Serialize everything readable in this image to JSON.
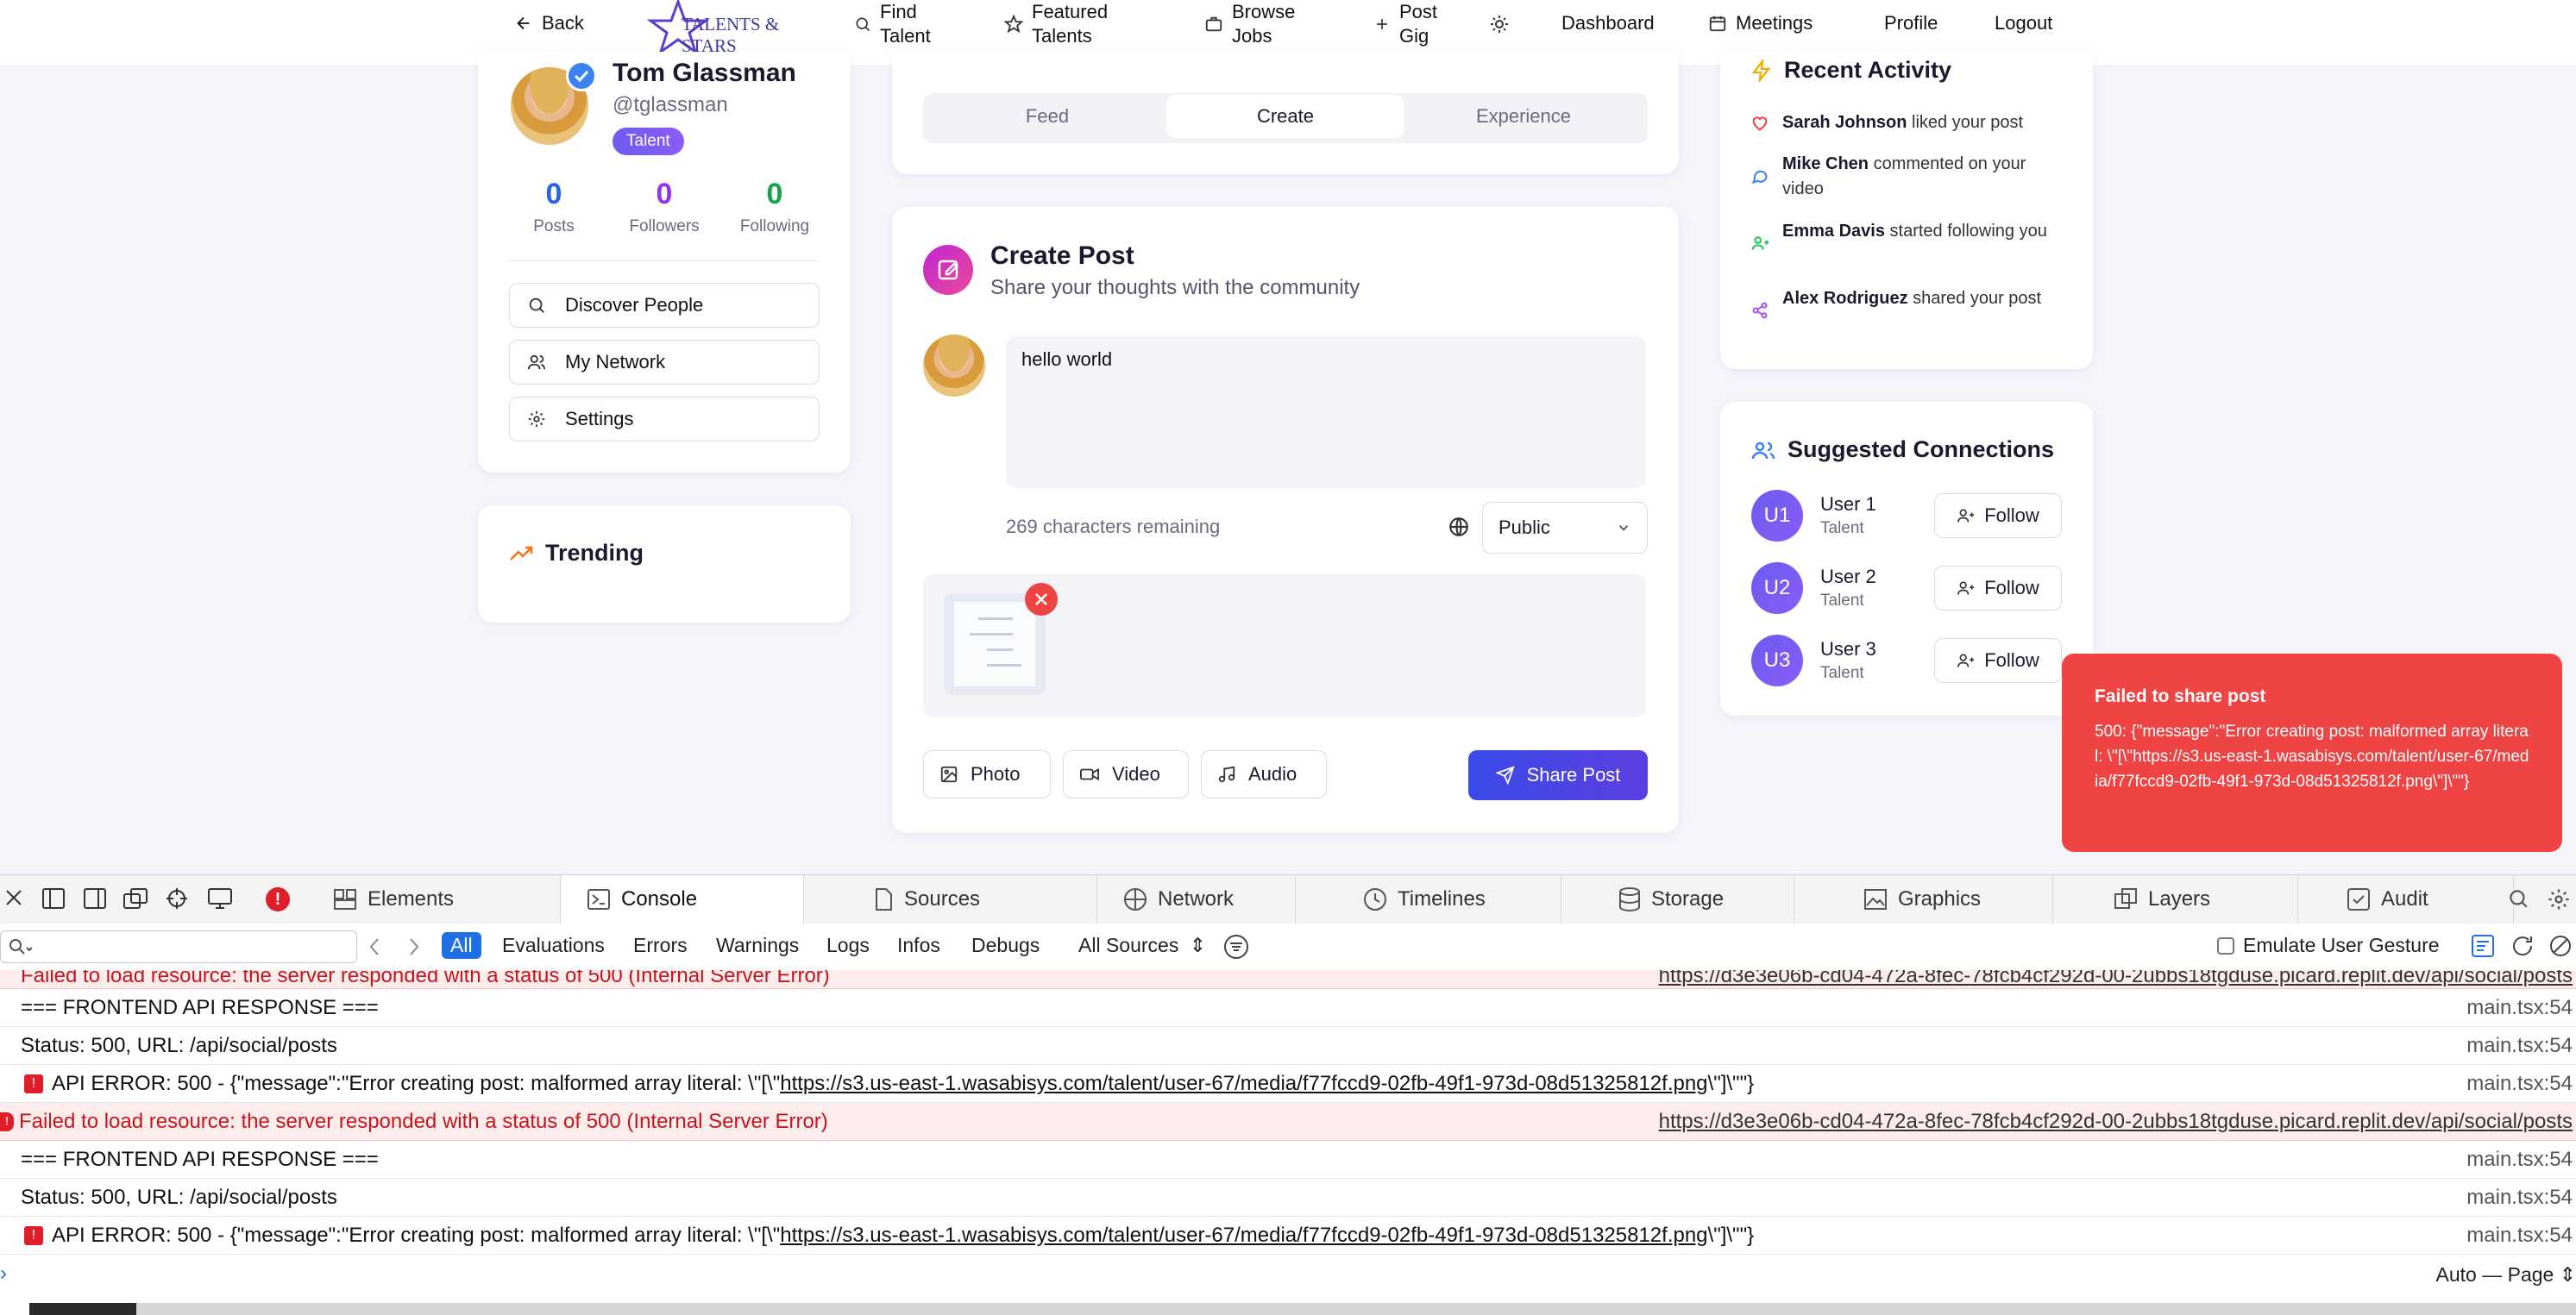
{
  "nav": {
    "back": "Back",
    "logo_text": "TALENTS & STARS",
    "find_talent": [
      "Find",
      "Talent"
    ],
    "featured_talents": [
      "Featured",
      "Talents"
    ],
    "browse_jobs": [
      "Browse",
      "Jobs"
    ],
    "post_gig": [
      "Post",
      "Gig"
    ],
    "dashboard": "Dashboard",
    "meetings": "Meetings",
    "profile": "Profile",
    "logout": "Logout"
  },
  "profile": {
    "name": "Tom Glassman",
    "handle": "@tglassman",
    "badge": "Talent",
    "stats": [
      {
        "value": "0",
        "label": "Posts",
        "color": "#2563eb"
      },
      {
        "value": "0",
        "label": "Followers",
        "color": "#9333ea"
      },
      {
        "value": "0",
        "label": "Following",
        "color": "#16a34a"
      }
    ],
    "links": [
      "Discover People",
      "My Network",
      "Settings"
    ]
  },
  "trending": {
    "title": "Trending"
  },
  "tabs": [
    "Feed",
    "Create",
    "Experience"
  ],
  "create_post": {
    "title": "Create Post",
    "subtitle": "Share your thoughts with the community",
    "text": "hello world",
    "chars_remaining": "269 characters remaining",
    "visibility": "Public",
    "buttons": {
      "photo": "Photo",
      "video": "Video",
      "audio": "Audio",
      "share": "Share Post"
    }
  },
  "recent_activity": {
    "title": "Recent Activity",
    "items": [
      {
        "who": "Sarah Johnson",
        "what": " liked your post",
        "icon": "heart-icon"
      },
      {
        "who": "Mike Chen",
        "what": " commented on your video",
        "icon": "message-icon"
      },
      {
        "who": "Emma Davis",
        "what": " started following you",
        "icon": "user-plus-icon"
      },
      {
        "who": "Alex Rodriguez",
        "what": " shared your post",
        "icon": "share-icon"
      }
    ]
  },
  "suggested": {
    "title": "Suggested Connections",
    "follow_label": "Follow",
    "users": [
      {
        "initials": "U1",
        "name": "User 1",
        "role": "Talent"
      },
      {
        "initials": "U2",
        "name": "User 2",
        "role": "Talent"
      },
      {
        "initials": "U3",
        "name": "User 3",
        "role": "Talent"
      }
    ]
  },
  "toast": {
    "title": "Failed to share post",
    "message": "500: {\"message\":\"Error creating post: malformed array literal: \\\"[\\\"https://s3.us-east-1.wasabisys.com/talent/user-67/media/f77fccd9-02fb-49f1-973d-08d51325812f.png\\\"]\\\"\"}"
  },
  "devtools": {
    "tabs": [
      "Elements",
      "Console",
      "Sources",
      "Network",
      "Timelines",
      "Storage",
      "Graphics",
      "Layers",
      "Audit"
    ],
    "filters": [
      "All",
      "Evaluations",
      "Errors",
      "Warnings",
      "Logs",
      "Infos",
      "Debugs"
    ],
    "all_sources": "All Sources",
    "emulate": "Emulate User Gesture",
    "footer_mode": "Auto — Page",
    "rows": [
      {
        "type": "err-partial",
        "text": "Failed to load resource: the server responded with a status of 500 (Internal Server Error)",
        "src": "https://d3e3e06b-cd04-472a-8fec-78fcb4cf292d-00-2ubbs18tgduse.picard.replit.dev/api/social/posts"
      },
      {
        "type": "log",
        "text": "=== FRONTEND API RESPONSE ===",
        "src": "main.tsx:54"
      },
      {
        "type": "log",
        "text": "Status: 500, URL: /api/social/posts",
        "src": "main.tsx:54"
      },
      {
        "type": "api",
        "prefix": "API ERROR: 500 - {\"message\":\"Error creating post: malformed array literal: \\\"[\\\"",
        "url": "https://s3.us-east-1.wasabisys.com/talent/user-67/media/f77fccd9-02fb-49f1-973d-08d51325812f.png",
        "suffix": "\\\"]\\\"\"}",
        "src": "main.tsx:54"
      },
      {
        "type": "err",
        "text": "Failed to load resource: the server responded with a status of 500 (Internal Server Error)",
        "src": "https://d3e3e06b-cd04-472a-8fec-78fcb4cf292d-00-2ubbs18tgduse.picard.replit.dev/api/social/posts"
      },
      {
        "type": "log",
        "text": "=== FRONTEND API RESPONSE ===",
        "src": "main.tsx:54"
      },
      {
        "type": "log",
        "text": "Status: 500, URL: /api/social/posts",
        "src": "main.tsx:54"
      },
      {
        "type": "api",
        "prefix": "API ERROR: 500 - {\"message\":\"Error creating post: malformed array literal: \\\"[\\\"",
        "url": "https://s3.us-east-1.wasabisys.com/talent/user-67/media/f77fccd9-02fb-49f1-973d-08d51325812f.png",
        "suffix": "\\\"]\\\"\"}",
        "src": "main.tsx:54"
      }
    ]
  }
}
